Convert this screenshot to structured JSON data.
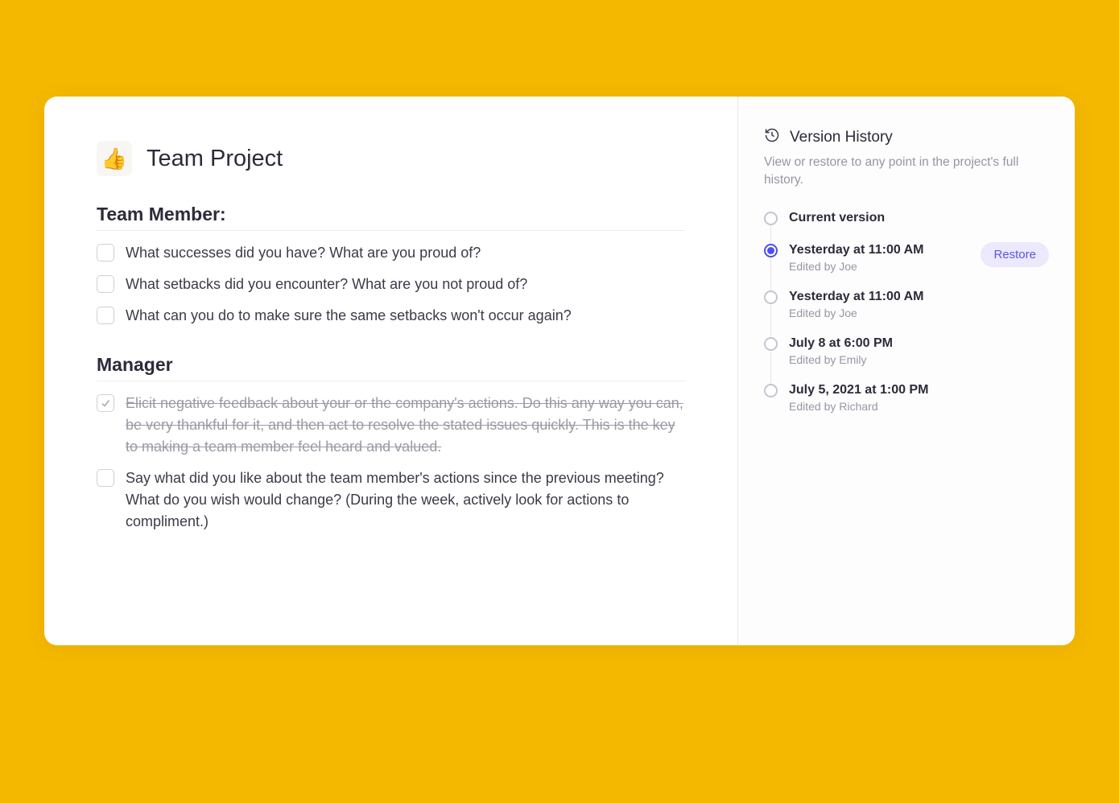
{
  "doc": {
    "icon": "👍",
    "title": "Team Project"
  },
  "sections": [
    {
      "heading": "Team Member:",
      "items": [
        {
          "text": "What successes did you have? What are you proud of?",
          "checked": false
        },
        {
          "text": "What setbacks did you encounter? What are you not proud of?",
          "checked": false
        },
        {
          "text": "What can you do to make sure the same setbacks won't occur again?",
          "checked": false
        }
      ]
    },
    {
      "heading": "Manager",
      "items": [
        {
          "text": "Elicit negative feedback about your or the company's actions. Do this any way you can, be very thankful for it, and then act to resolve the stated issues quickly. This is the key to making a team member feel heard and valued.",
          "checked": true
        },
        {
          "text": "Say what did you like about the team member's actions since the previous meeting? What do you wish would change? (During the week, actively look for actions to compliment.)",
          "checked": false
        }
      ]
    }
  ],
  "versionHistory": {
    "title": "Version History",
    "subtitle": "View or restore to any point in the project's full history.",
    "restoreLabel": "Restore",
    "items": [
      {
        "time": "Current version",
        "editor": "",
        "selected": false
      },
      {
        "time": "Yesterday at 11:00 AM",
        "editor": "Edited by Joe",
        "selected": true
      },
      {
        "time": "Yesterday at 11:00 AM",
        "editor": "Edited by Joe",
        "selected": false
      },
      {
        "time": "July 8 at 6:00 PM",
        "editor": "Edited by Emily",
        "selected": false
      },
      {
        "time": "July 5, 2021 at 1:00 PM",
        "editor": "Edited by Richard",
        "selected": false
      }
    ]
  }
}
